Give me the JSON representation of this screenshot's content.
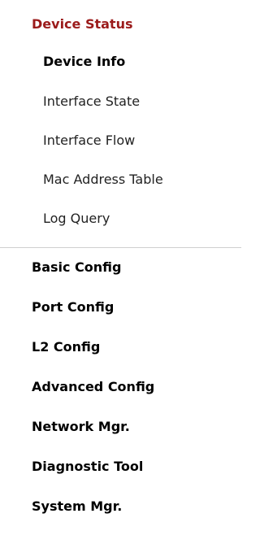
{
  "nav": {
    "active_group": {
      "label": "Device Status",
      "items": [
        {
          "label": "Device Info",
          "selected": true
        },
        {
          "label": "Interface State",
          "selected": false
        },
        {
          "label": "Interface Flow",
          "selected": false
        },
        {
          "label": "Mac Address Table",
          "selected": false
        },
        {
          "label": "Log Query",
          "selected": false
        }
      ]
    },
    "groups": [
      {
        "label": "Basic Config"
      },
      {
        "label": "Port Config"
      },
      {
        "label": "L2 Config"
      },
      {
        "label": "Advanced Config"
      },
      {
        "label": "Network Mgr."
      },
      {
        "label": "Diagnostic Tool"
      },
      {
        "label": "System Mgr."
      }
    ]
  },
  "colors": {
    "active_header": "#9b1b1b",
    "text": "#222222",
    "divider": "#cfcfcf"
  }
}
